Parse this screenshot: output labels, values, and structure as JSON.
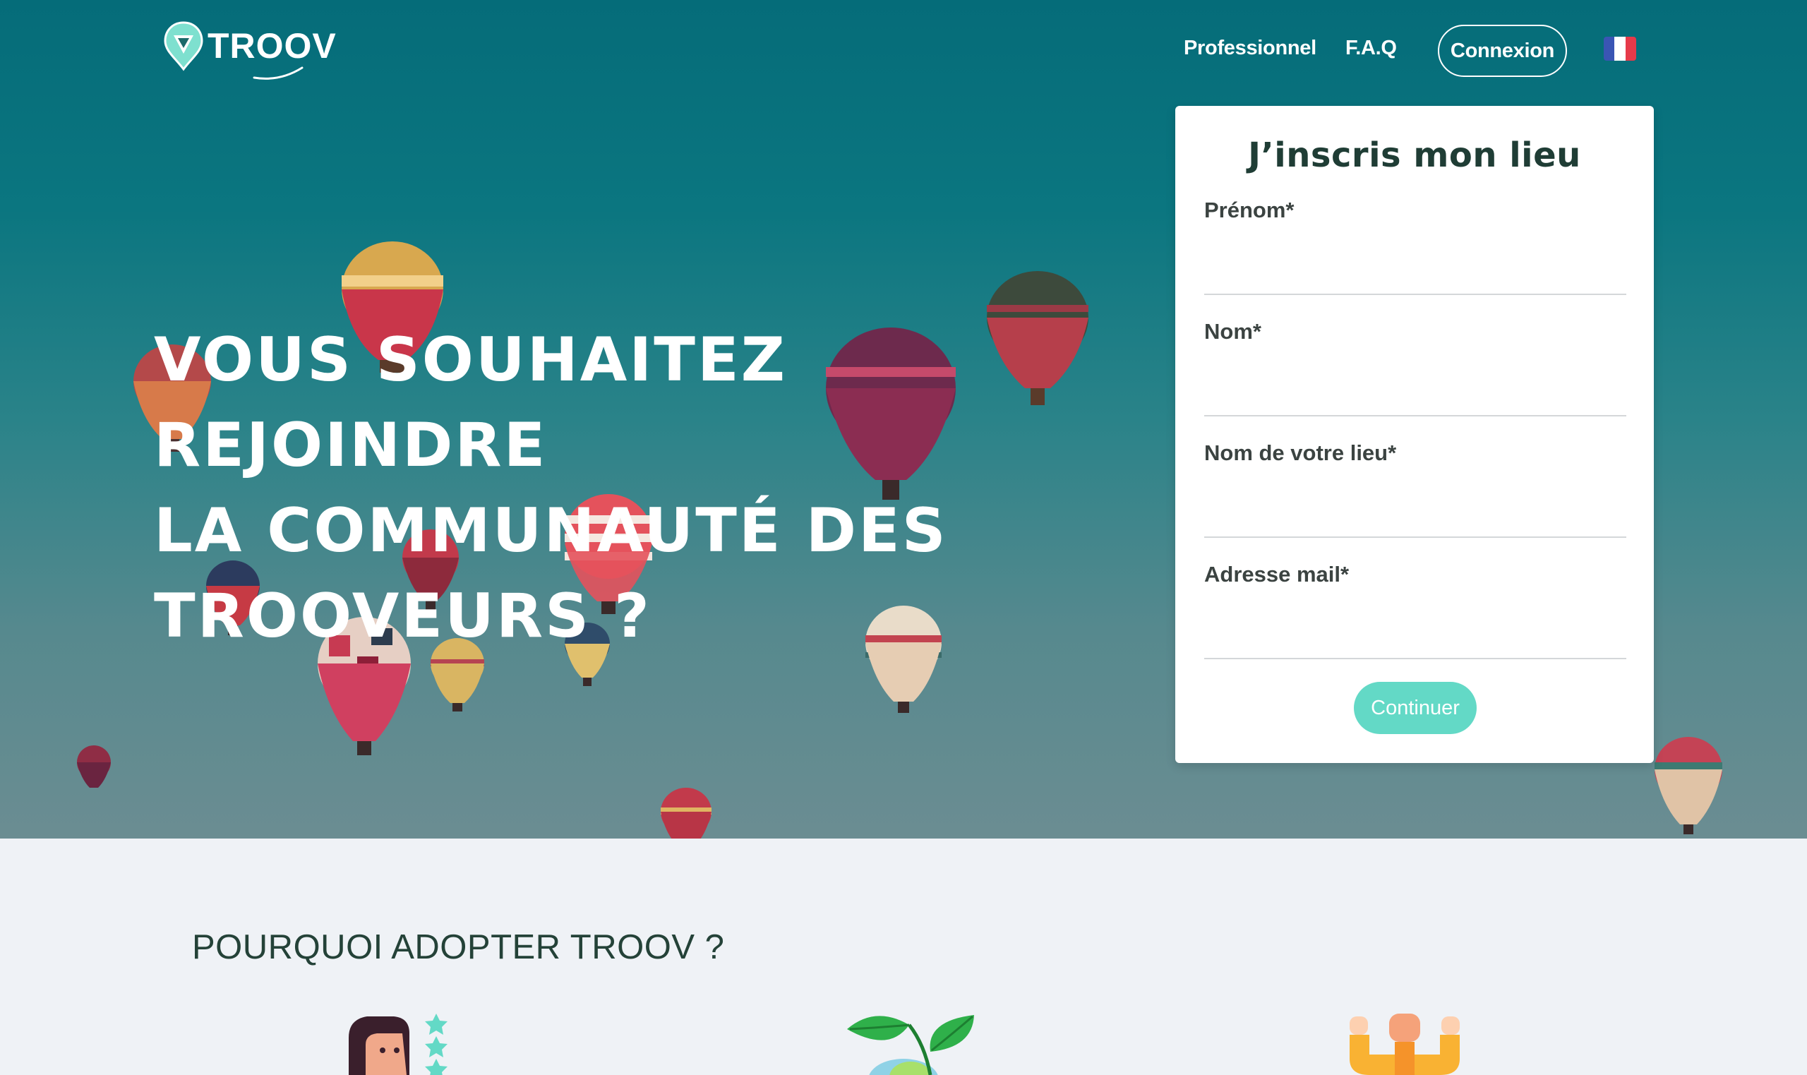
{
  "brand": {
    "name": "TROOV"
  },
  "nav": {
    "links": [
      {
        "label": "Professionnel"
      },
      {
        "label": "F.A.Q"
      }
    ],
    "login_label": "Connexion",
    "language_icon": "flag-fr-icon"
  },
  "hero": {
    "title_lines": [
      "VOUS SOUHAITEZ REJOINDRE",
      "LA COMMUNAUTÉ DES",
      "TROOVEURS ?"
    ]
  },
  "form": {
    "title": "J’inscris mon lieu",
    "fields": [
      {
        "label": "Prénom*",
        "value": ""
      },
      {
        "label": "Nom*",
        "value": ""
      },
      {
        "label": "Nom de votre lieu*",
        "value": ""
      },
      {
        "label": "Adresse mail*",
        "value": ""
      }
    ],
    "submit_label": "Continuer"
  },
  "why": {
    "title": "POURQUOI ADOPTER TROOV ?",
    "illustrations": [
      "person-rating-icon",
      "leaf-plant-icon",
      "strong-arms-icon"
    ]
  },
  "colors": {
    "accent": "#63d9c6",
    "hero_top": "#056c79",
    "hero_bottom": "#6b8d92",
    "text_dark": "#244238",
    "flag_blue": "#3a55b4",
    "flag_white": "#ffffff",
    "flag_red": "#e63a4a"
  }
}
